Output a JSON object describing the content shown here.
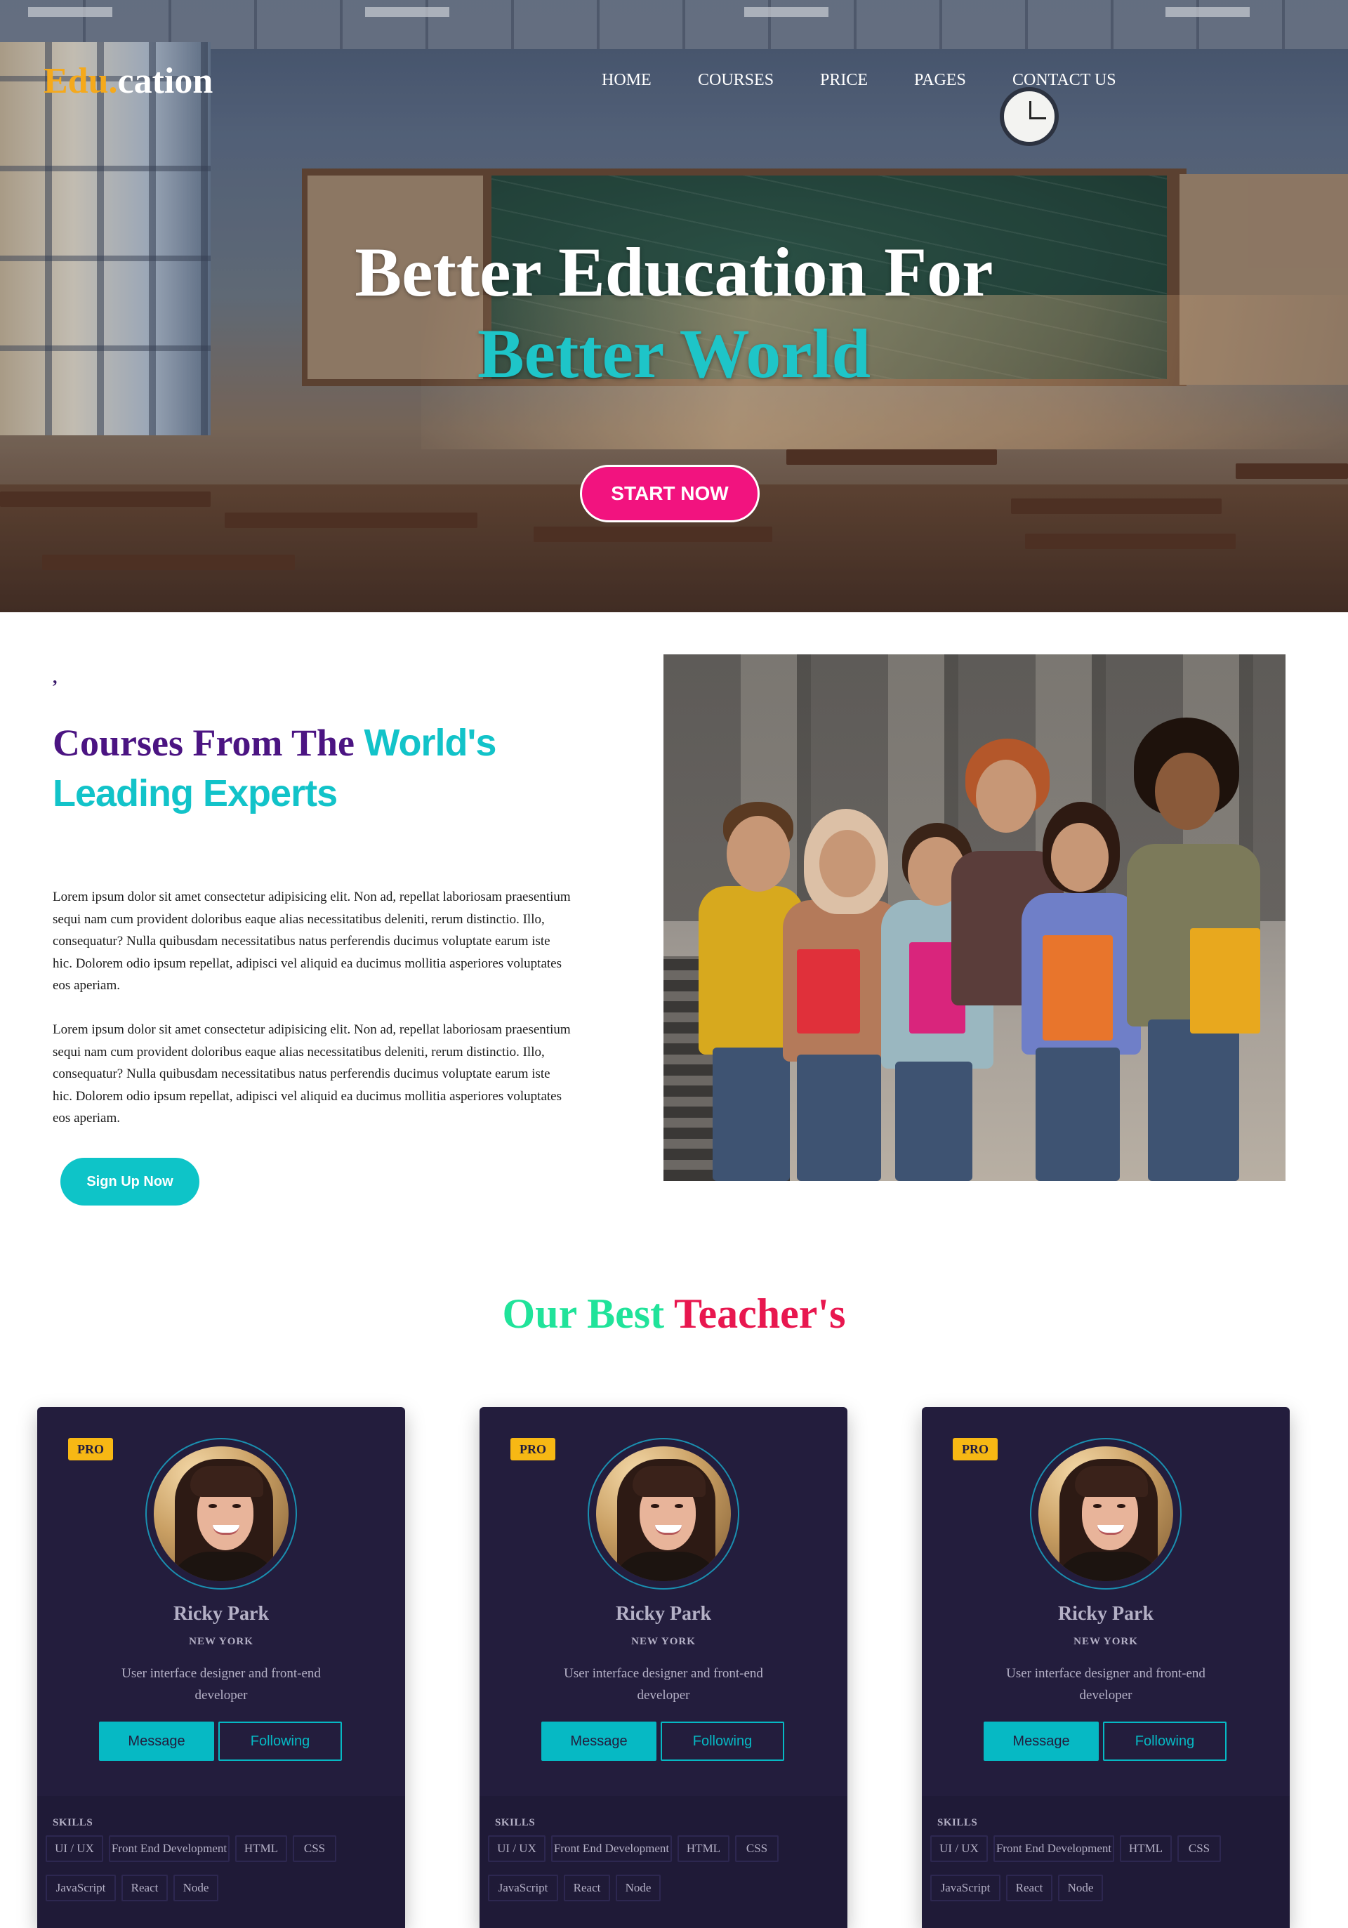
{
  "brand": {
    "logo_part1": "Edu.",
    "logo_part2": "cation",
    "accent": "#f5a91b"
  },
  "nav": {
    "items": [
      {
        "label": "HOME"
      },
      {
        "label": "COURSES"
      },
      {
        "label": "PRICE"
      },
      {
        "label": "PAGES"
      },
      {
        "label": "CONTACT US"
      }
    ]
  },
  "hero": {
    "title_line1": "Better Education For",
    "title_line2": "Better World",
    "cta_label": "START NOW",
    "cta_color": "#f2137f",
    "highlight_color": "#1ec5c8"
  },
  "courses": {
    "mark": ",",
    "heading_part1": "Courses From The",
    "heading_part2": "World's Leading Experts",
    "paragraph1": "Lorem ipsum dolor sit amet consectetur adipisicing elit. Non ad, repellat laboriosam praesentium sequi nam cum provident doloribus eaque alias necessitatibus deleniti, rerum distinctio. Illo, consequatur? Nulla quibusdam necessitatibus natus perferendis ducimus voluptate earum iste hic. Dolorem odio ipsum repellat, adipisci vel aliquid ea ducimus mollitia asperiores voluptates eos aperiam.",
    "paragraph2": "Lorem ipsum dolor sit amet consectetur adipisicing elit. Non ad, repellat laboriosam praesentium sequi nam cum provident doloribus eaque alias necessitatibus deleniti, rerum distinctio. Illo, consequatur? Nulla quibusdam necessitatibus natus perferendis ducimus voluptate earum iste hic. Dolorem odio ipsum repellat, adipisci vel aliquid ea ducimus mollitia asperiores voluptates eos aperiam.",
    "signup_label": "Sign Up Now"
  },
  "teachers": {
    "heading_part1": "Our Best",
    "heading_part2": "Teacher's",
    "cards": [
      {
        "badge": "PRO",
        "name": "Ricky Park",
        "city": "NEW YORK",
        "bio": "User interface designer and front-end developer",
        "message_label": "Message",
        "following_label": "Following",
        "skills_label": "SKILLS",
        "skills": [
          "UI / UX",
          "Front End Development",
          "HTML",
          "CSS",
          "JavaScript",
          "React",
          "Node"
        ]
      },
      {
        "badge": "PRO",
        "name": "Ricky Park",
        "city": "NEW YORK",
        "bio": "User interface designer and front-end developer",
        "message_label": "Message",
        "following_label": "Following",
        "skills_label": "SKILLS",
        "skills": [
          "UI / UX",
          "Front End Development",
          "HTML",
          "CSS",
          "JavaScript",
          "React",
          "Node"
        ]
      },
      {
        "badge": "PRO",
        "name": "Ricky Park",
        "city": "NEW YORK",
        "bio": "User interface designer and front-end developer",
        "message_label": "Message",
        "following_label": "Following",
        "skills_label": "SKILLS",
        "skills": [
          "UI / UX",
          "Front End Development",
          "HTML",
          "CSS",
          "JavaScript",
          "React",
          "Node"
        ]
      }
    ]
  }
}
